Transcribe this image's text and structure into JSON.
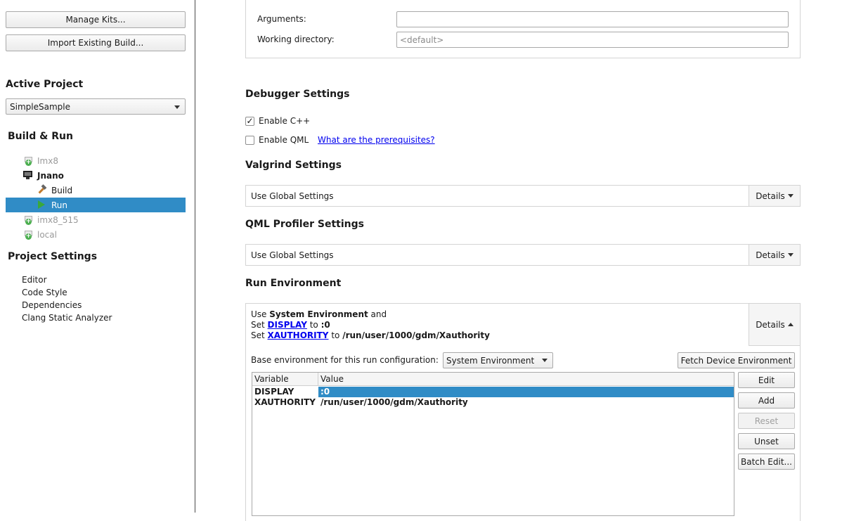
{
  "sidebar": {
    "manage_kits_label": "Manage Kits...",
    "import_build_label": "Import Existing Build...",
    "active_project_heading": "Active Project",
    "active_project_value": "SimpleSample",
    "build_run_heading": "Build & Run",
    "kits": [
      {
        "label": "Imx8",
        "state": "disabled"
      },
      {
        "label": "Jnano",
        "state": "active"
      },
      {
        "label": "Build",
        "state": "child"
      },
      {
        "label": "Run",
        "state": "selected"
      },
      {
        "label": "imx8_515",
        "state": "disabled"
      },
      {
        "label": "local",
        "state": "disabled"
      }
    ],
    "project_settings_heading": "Project Settings",
    "project_settings": [
      "Editor",
      "Code Style",
      "Dependencies",
      "Clang Static Analyzer"
    ]
  },
  "run_settings": {
    "arguments_label": "Arguments:",
    "arguments_value": "",
    "working_dir_label": "Working directory:",
    "working_dir_placeholder": "<default>"
  },
  "debugger": {
    "title": "Debugger Settings",
    "enable_cpp_label": "Enable C++",
    "enable_cpp_checked": true,
    "enable_qml_label": "Enable QML",
    "enable_qml_checked": false,
    "prerequisites_link": "What are the prerequisites?"
  },
  "valgrind": {
    "title": "Valgrind Settings",
    "value": "Use Global Settings",
    "details_label": "Details"
  },
  "qml_profiler": {
    "title": "QML Profiler Settings",
    "value": "Use Global Settings",
    "details_label": "Details"
  },
  "run_env": {
    "title": "Run Environment",
    "summary_use": "Use",
    "summary_base": "System Environment",
    "summary_and": "and",
    "summary_set": "Set",
    "summary_to": "to",
    "summary_vars": [
      {
        "name": "DISPLAY",
        "value": ":0"
      },
      {
        "name": "XAUTHORITY",
        "value": "/run/user/1000/gdm/Xauthority"
      }
    ],
    "details_label": "Details",
    "base_env_label": "Base environment for this run configuration:",
    "base_env_value": "System Environment",
    "fetch_button_label": "Fetch Device Environment",
    "table_headers": {
      "variable": "Variable",
      "value": "Value"
    },
    "table_rows": [
      {
        "variable": "DISPLAY",
        "value": ":0",
        "selected": true
      },
      {
        "variable": "XAUTHORITY",
        "value": "/run/user/1000/gdm/Xauthority",
        "selected": false
      }
    ],
    "buttons": {
      "edit": "Edit",
      "add": "Add",
      "reset": "Reset",
      "unset": "Unset",
      "batch_edit": "Batch Edit..."
    }
  },
  "colors": {
    "selection": "#308cc6",
    "link": "#0000ee"
  }
}
